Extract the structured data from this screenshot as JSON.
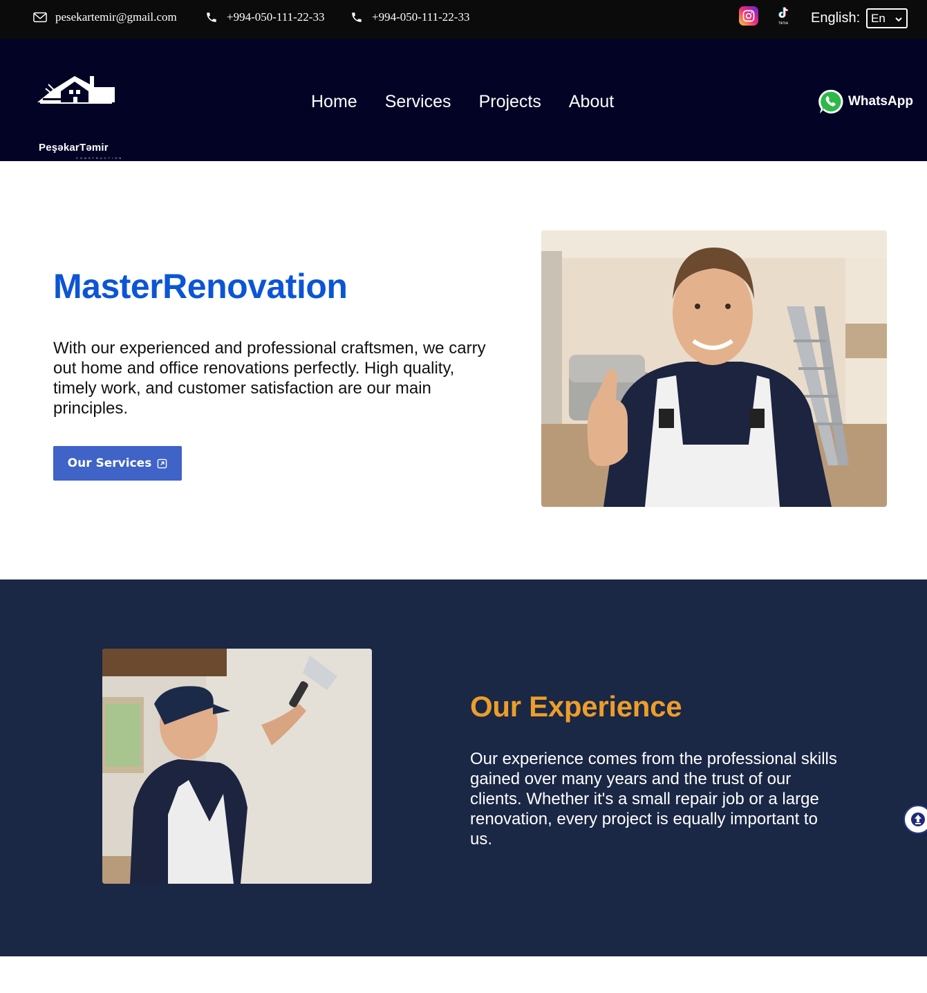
{
  "topbar": {
    "email": "pesekartemir@gmail.com",
    "phone1": "+994-050-111-22-33",
    "phone2": "+994-050-111-22-33",
    "social": {
      "instagram_icon": "instagram-icon",
      "tiktok_icon": "tiktok-icon",
      "tiktok_word": "TikTok"
    },
    "language_label": "English:",
    "language_value": "En"
  },
  "nav": {
    "logo_name": "PeşəkarTəmir",
    "logo_sub": "CONSTRUCTION",
    "links": [
      "Home",
      "Services",
      "Projects",
      "About"
    ],
    "whatsapp_label": "WhatsApp"
  },
  "hero": {
    "title": "MasterRenovation",
    "text": "With our experienced and professional craftsmen, we carry out home and office renovations perfectly. High quality, timely work, and customer satisfaction are our main principles.",
    "button_label": "Our Services"
  },
  "experience": {
    "title": "Our Experience",
    "text": "Our experience comes from the professional skills gained over many years and the trust of our clients. Whether it's a small repair job or a large renovation, every project is equally important to us."
  },
  "colors": {
    "topbar_bg": "#0b0b0b",
    "nav_bg": "#030326",
    "hero_title": "#0b55d6",
    "button_bg": "#3f63c6",
    "experience_bg": "#1a2745",
    "experience_title": "#ec9d2a"
  }
}
